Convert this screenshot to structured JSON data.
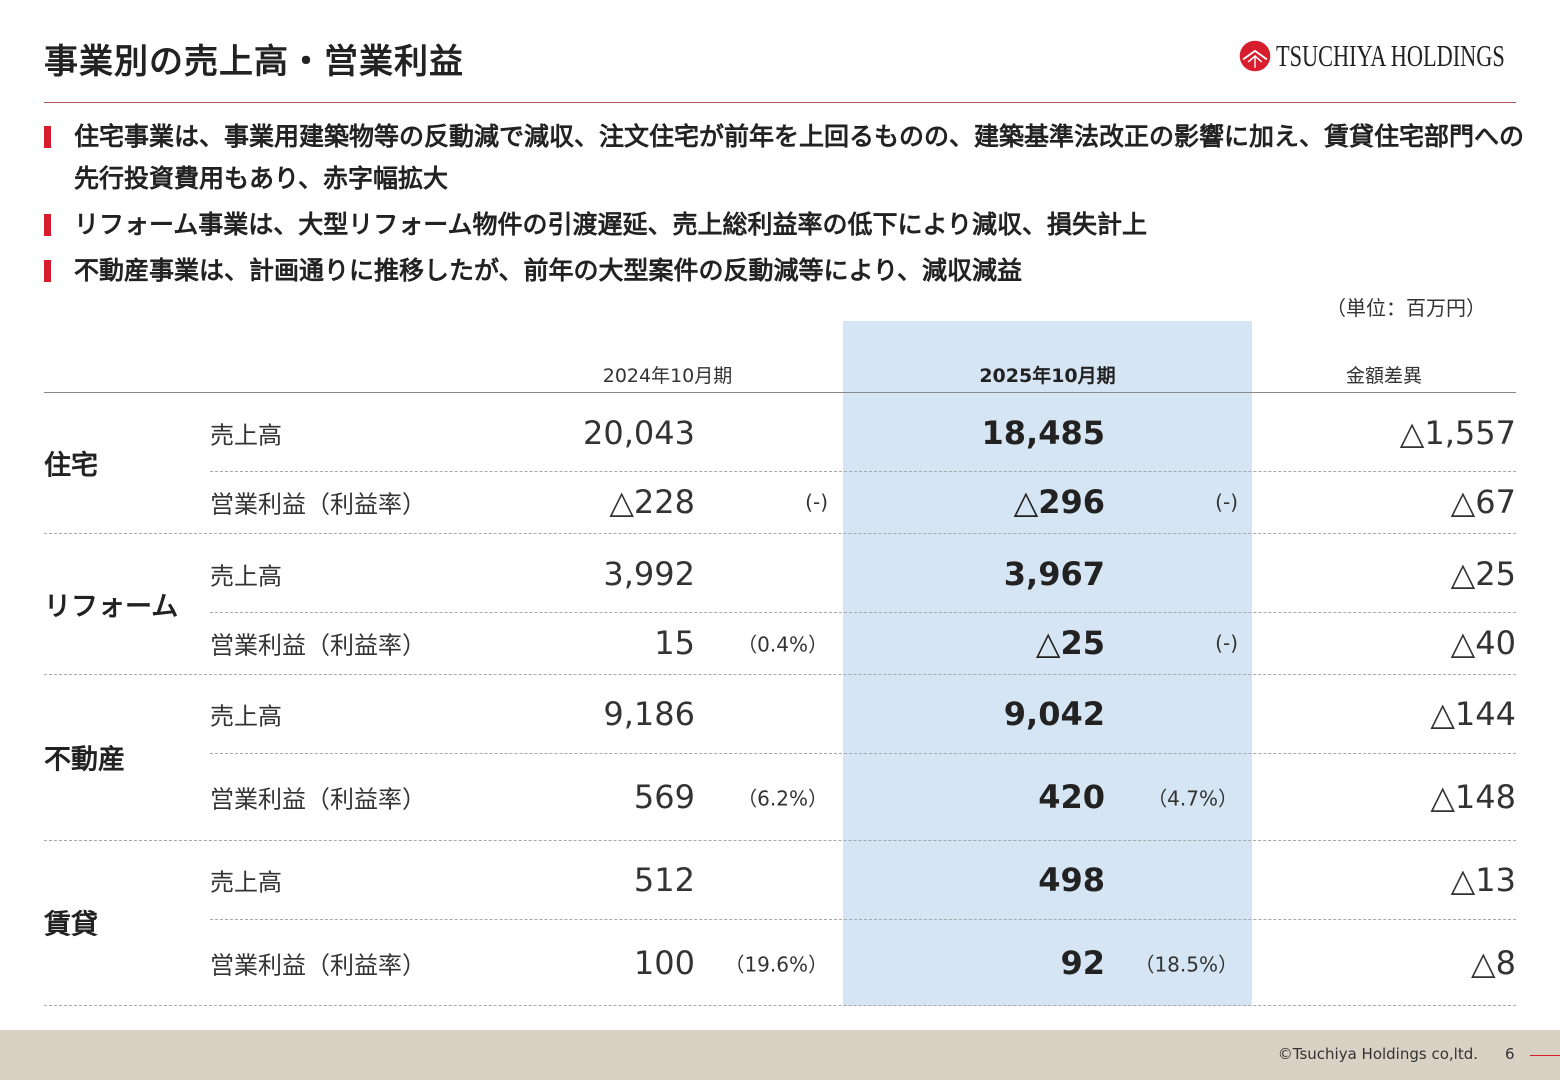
{
  "header": {
    "title": "事業別の売上高・営業利益",
    "logo_text": "TSUCHIYA HOLDINGS",
    "logo_color": "#d81e2c"
  },
  "bullets": [
    "住宅事業は、事業用建築物等の反動減で減収、注文住宅が前年を上回るものの、建築基準法改正の影響に加え、賃貸住宅部門への先行投資費用もあり、赤字幅拡大",
    "リフォーム事業は、大型リフォーム物件の引渡遅延、売上総利益率の低下により減収、損失計上",
    "不動産事業は、計画通りに推移したが、前年の大型案件の反動減等により、減収減益"
  ],
  "unit_label": "（単位：百万円）",
  "table": {
    "col_fy2024": "2024年10月期",
    "col_fy2025": "2025年10月期",
    "col_diff": "金額差異",
    "highlight_color": "#d5e5f3",
    "segments": [
      {
        "name": "住宅",
        "rows": [
          {
            "label": "売上高",
            "fy2024": "20,043",
            "fy2024_pct": "",
            "fy2025": "18,485",
            "fy2025_pct": "",
            "diff": "△1,557"
          },
          {
            "label": "営業利益（利益率）",
            "fy2024": "△228",
            "fy2024_pct": "(-)",
            "fy2025": "△296",
            "fy2025_pct": "(-)",
            "diff": "△67"
          }
        ]
      },
      {
        "name": "リフォーム",
        "rows": [
          {
            "label": "売上高",
            "fy2024": "3,992",
            "fy2024_pct": "",
            "fy2025": "3,967",
            "fy2025_pct": "",
            "diff": "△25"
          },
          {
            "label": "営業利益（利益率）",
            "fy2024": "15",
            "fy2024_pct": "（0.4%）",
            "fy2025": "△25",
            "fy2025_pct": "(-)",
            "diff": "△40"
          }
        ]
      },
      {
        "name": "不動産",
        "rows": [
          {
            "label": "売上高",
            "fy2024": "9,186",
            "fy2024_pct": "",
            "fy2025": "9,042",
            "fy2025_pct": "",
            "diff": "△144"
          },
          {
            "label": "営業利益（利益率）",
            "fy2024": "569",
            "fy2024_pct": "（6.2%）",
            "fy2025": "420",
            "fy2025_pct": "（4.7%）",
            "diff": "△148"
          }
        ]
      },
      {
        "name": "賃貸",
        "rows": [
          {
            "label": "売上高",
            "fy2024": "512",
            "fy2024_pct": "",
            "fy2025": "498",
            "fy2025_pct": "",
            "diff": "△13"
          },
          {
            "label": "営業利益（利益率）",
            "fy2024": "100",
            "fy2024_pct": "（19.6%）",
            "fy2025": "92",
            "fy2025_pct": "（18.5%）",
            "diff": "△8"
          }
        ]
      }
    ]
  },
  "footer": {
    "copyright": "©Tsuchiya Holdings co,ltd.",
    "page_number": "6"
  }
}
